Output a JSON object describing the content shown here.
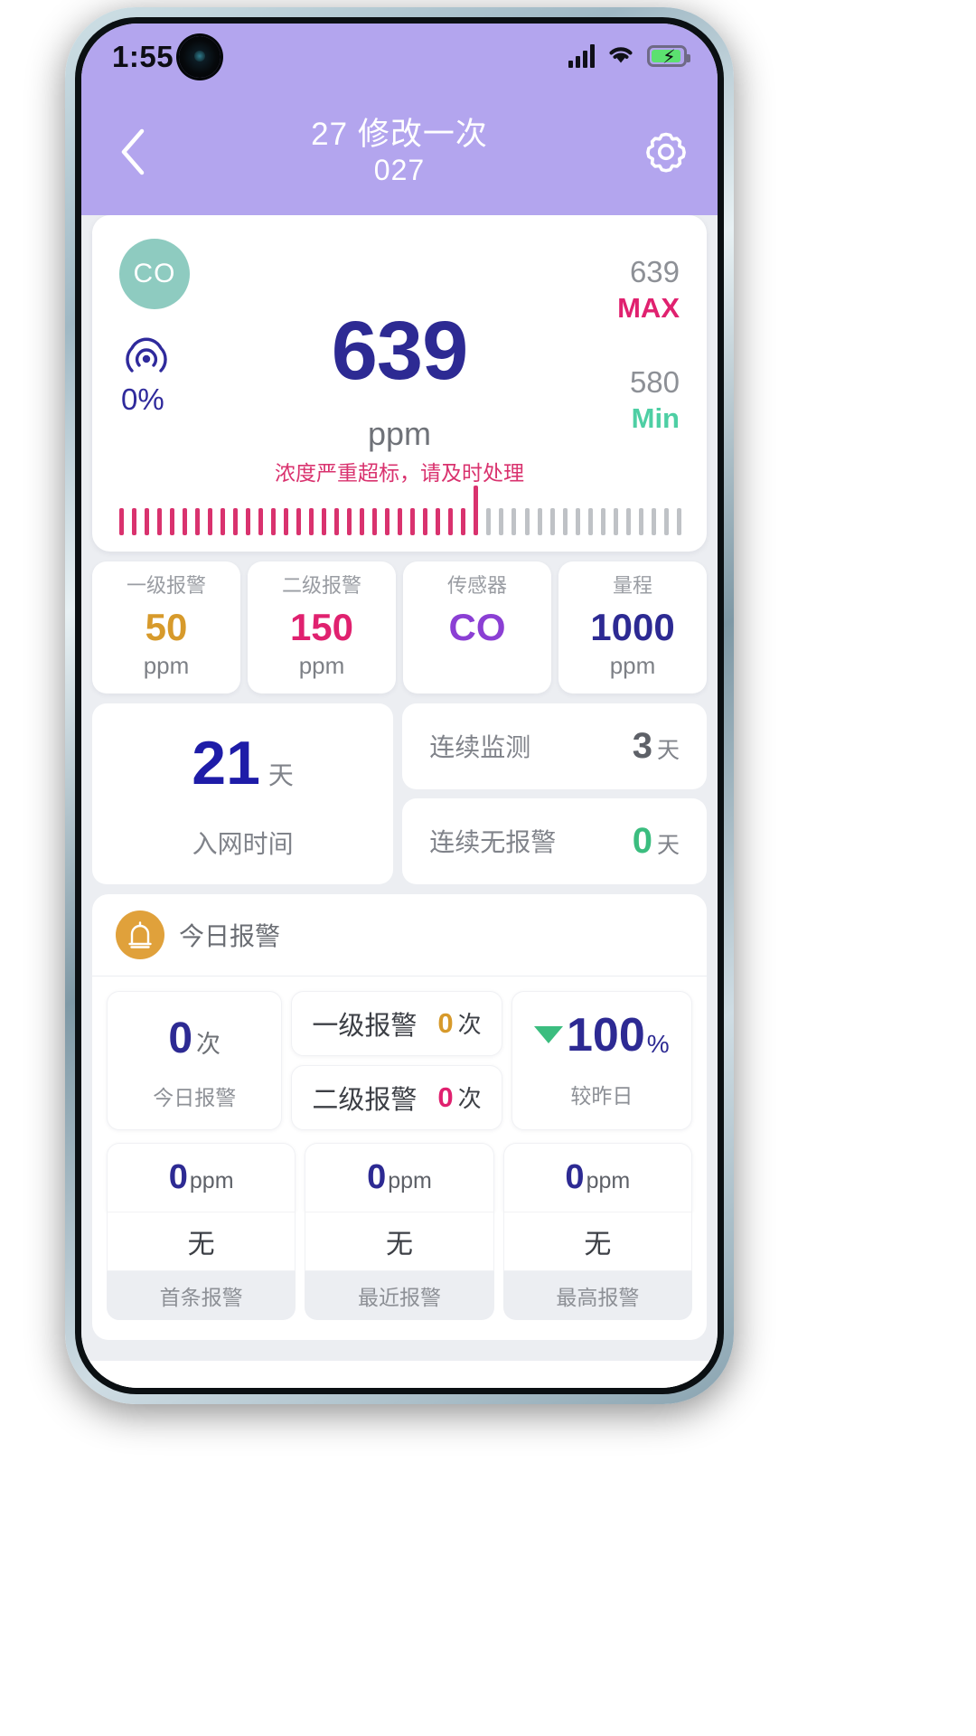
{
  "status_bar": {
    "time": "1:55",
    "signal_icon": "cellular-signal-icon",
    "wifi_icon": "wifi-icon",
    "battery_icon": "battery-charging-icon"
  },
  "header": {
    "back_icon": "chevron-left-icon",
    "title": "27 修改一次",
    "subtitle": "027",
    "settings_icon": "gear-icon",
    "background_color": "#b3a5ee"
  },
  "gauge": {
    "sensor_badge": "CO",
    "signal_icon": "broadcast-signal-icon",
    "signal_percent": "0%",
    "value": "639",
    "unit": "ppm",
    "warning": "浓度严重超标，请及时处理",
    "max_value": "639",
    "max_label": "MAX",
    "min_value": "580",
    "min_label": "Min",
    "colors": {
      "value": "#2d2a93",
      "max": "#e0216f",
      "min": "#4ecfa4",
      "warning": "#d9326e",
      "badge_bg": "#8ecbc0"
    },
    "chart_data": {
      "type": "bar",
      "title": "浓度刻度条",
      "categories": [
        "1",
        "2",
        "3",
        "4",
        "5",
        "6",
        "7",
        "8",
        "9",
        "10",
        "11",
        "12",
        "13",
        "14",
        "15",
        "16",
        "17",
        "18",
        "19",
        "20",
        "21",
        "22",
        "23",
        "24",
        "25",
        "26",
        "27",
        "28",
        "29",
        "30",
        "31",
        "32",
        "33",
        "34",
        "35",
        "36",
        "37",
        "38",
        "39",
        "40",
        "41",
        "42",
        "43",
        "44",
        "45"
      ],
      "values": [
        30,
        30,
        30,
        30,
        30,
        30,
        30,
        30,
        30,
        30,
        30,
        30,
        30,
        30,
        30,
        30,
        30,
        30,
        30,
        30,
        30,
        30,
        30,
        30,
        30,
        30,
        30,
        30,
        55,
        30,
        30,
        30,
        30,
        30,
        30,
        30,
        30,
        30,
        30,
        30,
        30,
        30,
        30,
        30,
        30
      ],
      "filled_count": 29,
      "indicator_index": 28,
      "active_color": "#d9326e",
      "inactive_color": "#bfc2c6",
      "xlabel": "",
      "ylabel": ""
    }
  },
  "thresholds": [
    {
      "label": "一级报警",
      "value": "50",
      "unit": "ppm",
      "color_class": "v-gold"
    },
    {
      "label": "二级报警",
      "value": "150",
      "unit": "ppm",
      "color_class": "v-pink"
    },
    {
      "label": "传感器",
      "value": "CO",
      "unit": "",
      "color_class": "v-purple"
    },
    {
      "label": "量程",
      "value": "1000",
      "unit": "ppm",
      "color_class": "v-indigo"
    }
  ],
  "days": {
    "join": {
      "value": "21",
      "unit": "天",
      "label": "入网时间"
    },
    "monitor": {
      "label": "连续监测",
      "value": "3",
      "unit": "天"
    },
    "no_alarm": {
      "label": "连续无报警",
      "value": "0",
      "unit": "天"
    }
  },
  "today_alarm": {
    "icon": "alarm-bell-icon",
    "title": "今日报警",
    "count": {
      "value": "0",
      "unit": "次",
      "label": "今日报警"
    },
    "level1": {
      "label": "一级报警",
      "value": "0",
      "unit": "次",
      "color": "#d79a2b"
    },
    "level2": {
      "label": "二级报警",
      "value": "0",
      "unit": "次",
      "color": "#e0216f"
    },
    "trend": {
      "arrow": "down-triangle-icon",
      "value": "100",
      "percent": "%",
      "label": "较昨日"
    },
    "details": [
      {
        "value": "0",
        "unit": "ppm",
        "status": "无",
        "label": "首条报警"
      },
      {
        "value": "0",
        "unit": "ppm",
        "status": "无",
        "label": "最近报警"
      },
      {
        "value": "0",
        "unit": "ppm",
        "status": "无",
        "label": "最高报警"
      }
    ]
  }
}
